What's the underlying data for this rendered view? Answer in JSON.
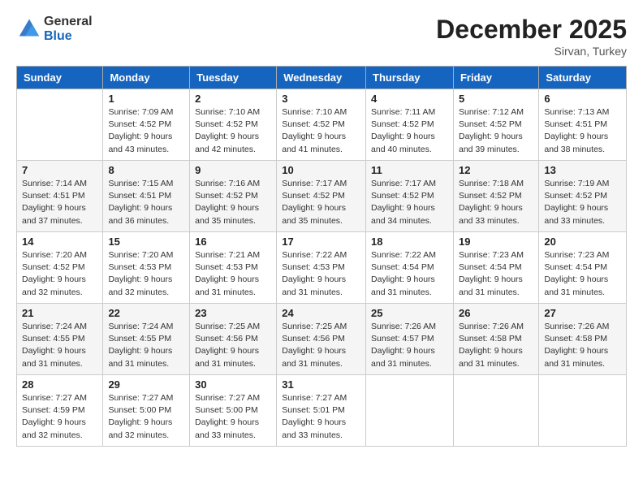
{
  "header": {
    "logo_line1": "General",
    "logo_line2": "Blue",
    "month": "December 2025",
    "location": "Sirvan, Turkey"
  },
  "days_of_week": [
    "Sunday",
    "Monday",
    "Tuesday",
    "Wednesday",
    "Thursday",
    "Friday",
    "Saturday"
  ],
  "weeks": [
    [
      {
        "day": "",
        "info": ""
      },
      {
        "day": "1",
        "info": "Sunrise: 7:09 AM\nSunset: 4:52 PM\nDaylight: 9 hours\nand 43 minutes."
      },
      {
        "day": "2",
        "info": "Sunrise: 7:10 AM\nSunset: 4:52 PM\nDaylight: 9 hours\nand 42 minutes."
      },
      {
        "day": "3",
        "info": "Sunrise: 7:10 AM\nSunset: 4:52 PM\nDaylight: 9 hours\nand 41 minutes."
      },
      {
        "day": "4",
        "info": "Sunrise: 7:11 AM\nSunset: 4:52 PM\nDaylight: 9 hours\nand 40 minutes."
      },
      {
        "day": "5",
        "info": "Sunrise: 7:12 AM\nSunset: 4:52 PM\nDaylight: 9 hours\nand 39 minutes."
      },
      {
        "day": "6",
        "info": "Sunrise: 7:13 AM\nSunset: 4:51 PM\nDaylight: 9 hours\nand 38 minutes."
      }
    ],
    [
      {
        "day": "7",
        "info": "Sunrise: 7:14 AM\nSunset: 4:51 PM\nDaylight: 9 hours\nand 37 minutes."
      },
      {
        "day": "8",
        "info": "Sunrise: 7:15 AM\nSunset: 4:51 PM\nDaylight: 9 hours\nand 36 minutes."
      },
      {
        "day": "9",
        "info": "Sunrise: 7:16 AM\nSunset: 4:52 PM\nDaylight: 9 hours\nand 35 minutes."
      },
      {
        "day": "10",
        "info": "Sunrise: 7:17 AM\nSunset: 4:52 PM\nDaylight: 9 hours\nand 35 minutes."
      },
      {
        "day": "11",
        "info": "Sunrise: 7:17 AM\nSunset: 4:52 PM\nDaylight: 9 hours\nand 34 minutes."
      },
      {
        "day": "12",
        "info": "Sunrise: 7:18 AM\nSunset: 4:52 PM\nDaylight: 9 hours\nand 33 minutes."
      },
      {
        "day": "13",
        "info": "Sunrise: 7:19 AM\nSunset: 4:52 PM\nDaylight: 9 hours\nand 33 minutes."
      }
    ],
    [
      {
        "day": "14",
        "info": "Sunrise: 7:20 AM\nSunset: 4:52 PM\nDaylight: 9 hours\nand 32 minutes."
      },
      {
        "day": "15",
        "info": "Sunrise: 7:20 AM\nSunset: 4:53 PM\nDaylight: 9 hours\nand 32 minutes."
      },
      {
        "day": "16",
        "info": "Sunrise: 7:21 AM\nSunset: 4:53 PM\nDaylight: 9 hours\nand 31 minutes."
      },
      {
        "day": "17",
        "info": "Sunrise: 7:22 AM\nSunset: 4:53 PM\nDaylight: 9 hours\nand 31 minutes."
      },
      {
        "day": "18",
        "info": "Sunrise: 7:22 AM\nSunset: 4:54 PM\nDaylight: 9 hours\nand 31 minutes."
      },
      {
        "day": "19",
        "info": "Sunrise: 7:23 AM\nSunset: 4:54 PM\nDaylight: 9 hours\nand 31 minutes."
      },
      {
        "day": "20",
        "info": "Sunrise: 7:23 AM\nSunset: 4:54 PM\nDaylight: 9 hours\nand 31 minutes."
      }
    ],
    [
      {
        "day": "21",
        "info": "Sunrise: 7:24 AM\nSunset: 4:55 PM\nDaylight: 9 hours\nand 31 minutes."
      },
      {
        "day": "22",
        "info": "Sunrise: 7:24 AM\nSunset: 4:55 PM\nDaylight: 9 hours\nand 31 minutes."
      },
      {
        "day": "23",
        "info": "Sunrise: 7:25 AM\nSunset: 4:56 PM\nDaylight: 9 hours\nand 31 minutes."
      },
      {
        "day": "24",
        "info": "Sunrise: 7:25 AM\nSunset: 4:56 PM\nDaylight: 9 hours\nand 31 minutes."
      },
      {
        "day": "25",
        "info": "Sunrise: 7:26 AM\nSunset: 4:57 PM\nDaylight: 9 hours\nand 31 minutes."
      },
      {
        "day": "26",
        "info": "Sunrise: 7:26 AM\nSunset: 4:58 PM\nDaylight: 9 hours\nand 31 minutes."
      },
      {
        "day": "27",
        "info": "Sunrise: 7:26 AM\nSunset: 4:58 PM\nDaylight: 9 hours\nand 31 minutes."
      }
    ],
    [
      {
        "day": "28",
        "info": "Sunrise: 7:27 AM\nSunset: 4:59 PM\nDaylight: 9 hours\nand 32 minutes."
      },
      {
        "day": "29",
        "info": "Sunrise: 7:27 AM\nSunset: 5:00 PM\nDaylight: 9 hours\nand 32 minutes."
      },
      {
        "day": "30",
        "info": "Sunrise: 7:27 AM\nSunset: 5:00 PM\nDaylight: 9 hours\nand 33 minutes."
      },
      {
        "day": "31",
        "info": "Sunrise: 7:27 AM\nSunset: 5:01 PM\nDaylight: 9 hours\nand 33 minutes."
      },
      {
        "day": "",
        "info": ""
      },
      {
        "day": "",
        "info": ""
      },
      {
        "day": "",
        "info": ""
      }
    ]
  ]
}
